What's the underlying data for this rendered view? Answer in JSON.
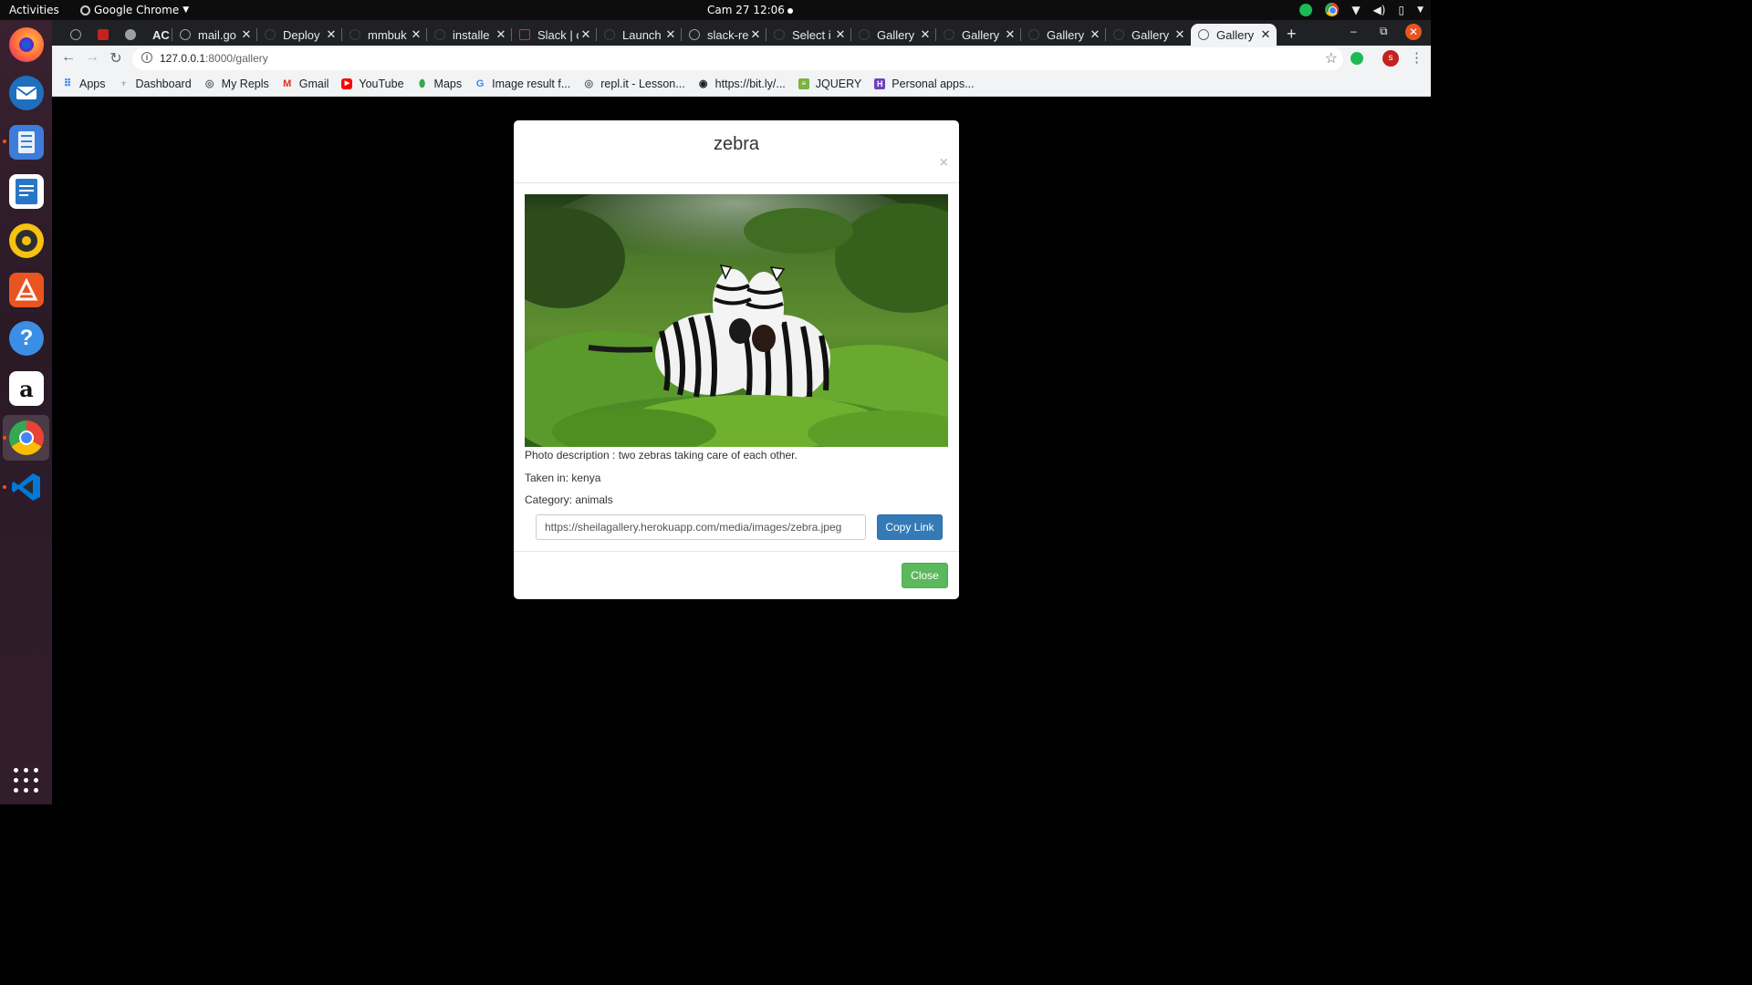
{
  "os": {
    "activities_label": "Activities",
    "app_menu_label": "Google Chrome",
    "clock": "Cam 27  12:06"
  },
  "dock": {
    "items": [
      {
        "name": "firefox",
        "color": "#e66000"
      },
      {
        "name": "thunderbird",
        "color": "#1f6fbf"
      },
      {
        "name": "files",
        "color": "#3d7dd9"
      },
      {
        "name": "libreoffice-writer",
        "color": "#2a76c6"
      },
      {
        "name": "rhythmbox",
        "color": "#f5c211"
      },
      {
        "name": "ubuntu-software",
        "color": "#e95420"
      },
      {
        "name": "help",
        "color": "#3a8ee6"
      },
      {
        "name": "amazon",
        "color": "#ffffff"
      },
      {
        "name": "chrome",
        "color": "#4285f4"
      },
      {
        "name": "vscode",
        "color": "#0078d7"
      }
    ]
  },
  "tabs": [
    {
      "label": ""
    },
    {
      "label": ""
    },
    {
      "label": ""
    },
    {
      "label": "AC"
    },
    {
      "label": "mail.go"
    },
    {
      "label": "Deploy"
    },
    {
      "label": "mmbuk"
    },
    {
      "label": "installe"
    },
    {
      "label": "Slack | c"
    },
    {
      "label": "Launch"
    },
    {
      "label": "slack-re"
    },
    {
      "label": "Select i"
    },
    {
      "label": "Gallery"
    },
    {
      "label": "Gallery"
    },
    {
      "label": "Gallery"
    },
    {
      "label": "Gallery"
    },
    {
      "label": "Gallery"
    }
  ],
  "toolbar": {
    "url_host": "127.0.0.1",
    "url_path": ":8000/gallery",
    "avatar_letter": "s"
  },
  "bookmarks": [
    {
      "label": "Apps",
      "icon": "apps-grid-icon",
      "color": "#1a73e8"
    },
    {
      "label": "Dashboard",
      "icon": "dashboard-icon",
      "color": "#8d6e63"
    },
    {
      "label": "My Repls",
      "icon": "repl-icon",
      "color": "#5f6368"
    },
    {
      "label": "Gmail",
      "icon": "gmail-icon",
      "color": "#d93025"
    },
    {
      "label": "YouTube",
      "icon": "youtube-icon",
      "color": "#ff0000"
    },
    {
      "label": "Maps",
      "icon": "maps-icon",
      "color": "#34a853"
    },
    {
      "label": "Image result f...",
      "icon": "google-icon",
      "color": "#4285f4"
    },
    {
      "label": "repl.it - Lesson...",
      "icon": "repl-icon",
      "color": "#5f6368"
    },
    {
      "label": "https://bit.ly/...",
      "icon": "globe-icon",
      "color": "#202124"
    },
    {
      "label": "JQUERY",
      "icon": "jquery-icon",
      "color": "#7cb342"
    },
    {
      "label": "Personal apps...",
      "icon": "heroku-icon",
      "color": "#6f42c1"
    }
  ],
  "modal": {
    "title": "zebra",
    "close_x": "×",
    "description": "Photo description : two zebras taking care of each other.",
    "location": "Taken in: kenya",
    "category": "Category: animals",
    "link_value": "https://sheilagallery.herokuapp.com/media/images/zebra.jpeg",
    "copy_button": "Copy Link",
    "close_button": "Close"
  }
}
